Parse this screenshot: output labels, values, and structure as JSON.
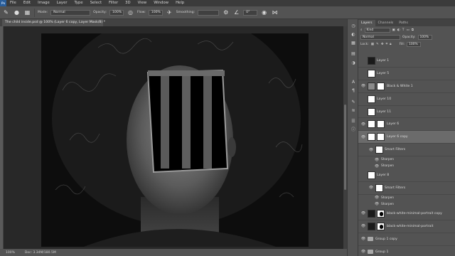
{
  "menu": [
    "File",
    "Edit",
    "Image",
    "Layer",
    "Type",
    "Select",
    "Filter",
    "3D",
    "View",
    "Window",
    "Help"
  ],
  "options": {
    "mode_label": "Mode:",
    "mode_value": "Normal",
    "opacity_label": "Opacity:",
    "opacity_value": "100%",
    "flow_label": "Flow:",
    "flow_value": "100%",
    "smoothing_label": "Smoothing:",
    "angle_value": "0°"
  },
  "document": {
    "tab_title": "The child inside.psd @ 100% (Layer 6 copy, Layer Mask/8) *"
  },
  "status": {
    "zoom": "100%",
    "doc": "Doc: 3.34M/180.5M"
  },
  "panel": {
    "tabs": [
      "Layers",
      "Channels",
      "Paths"
    ],
    "kind": "Kind",
    "blend": "Normal",
    "opacity_label": "Opacity:",
    "opacity_value": "100%",
    "lock_label": "Lock:",
    "fill_label": "Fill:",
    "fill_value": "100%"
  },
  "layers": [
    {
      "name": "Layer 1",
      "thumb": "dark",
      "mask": false,
      "eye": false
    },
    {
      "name": "Layer 5",
      "thumb": "white",
      "mask": false,
      "eye": false
    },
    {
      "name": "Black & White 1",
      "thumb": "gray",
      "mask": true,
      "eye": true
    },
    {
      "name": "Layer 10",
      "thumb": "white",
      "mask": false,
      "eye": false
    },
    {
      "name": "Layer 11",
      "thumb": "white",
      "mask": false,
      "eye": false
    },
    {
      "name": "Layer 6",
      "thumb": "white",
      "mask": true,
      "eye": true
    },
    {
      "name": "Layer 6 copy",
      "thumb": "white",
      "mask": true,
      "eye": true,
      "selected": true
    },
    {
      "name": "Smart Filters",
      "thumb": "white",
      "mask": false,
      "eye": true,
      "indent": true
    },
    {
      "name": "Sharpen",
      "sub": true
    },
    {
      "name": "Sharpen",
      "sub": true
    },
    {
      "name": "Layer 8",
      "thumb": "white",
      "mask": false,
      "eye": false
    },
    {
      "name": "Smart Filters",
      "thumb": "white",
      "mask": false,
      "eye": true,
      "indent": true
    },
    {
      "name": "Sharpen",
      "sub": true
    },
    {
      "name": "Sharpen",
      "sub": true
    },
    {
      "name": "black-white-minimal-portrait copy",
      "thumb": "dark",
      "mask": true,
      "maskBlack": true,
      "eye": true
    },
    {
      "name": "black-white-minimal-portrait",
      "thumb": "dark",
      "mask": true,
      "maskBlack": true,
      "eye": true
    },
    {
      "name": "Group 1 copy",
      "group": true,
      "eye": true
    },
    {
      "name": "Group 1",
      "group": true,
      "eye": true
    }
  ],
  "colors": {
    "ui_bg": "#535353",
    "menubar": "#3b3b3b",
    "canvas_bg": "#282828",
    "selected_row": "#6b6b6b"
  },
  "icons": [
    "brush-icon",
    "brush-preset-icon",
    "brush-settings-icon",
    "pressure-opacity-icon",
    "airbrush-icon",
    "angle-icon",
    "pressure-size-icon",
    "symmetry-icon"
  ]
}
